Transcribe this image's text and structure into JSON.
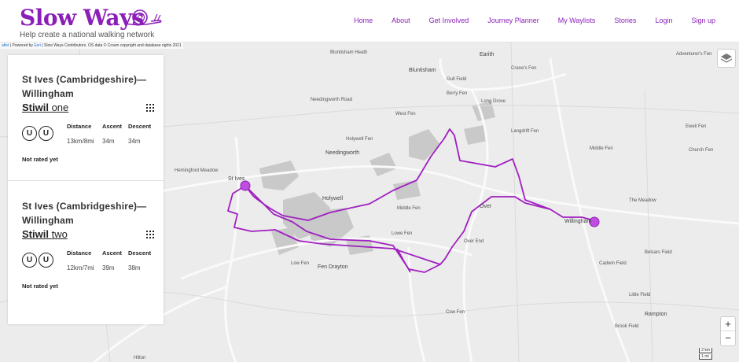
{
  "header": {
    "logo": "Slow Ways",
    "tagline": "Help create a national walking network",
    "nav": [
      "Home",
      "About",
      "Get Involved",
      "Journey Planner",
      "My Waylists",
      "Stories",
      "Login",
      "Sign up"
    ]
  },
  "map": {
    "attribution_prefix": "aflet",
    "attribution_powered": "| Powered by",
    "attribution_esri": "Esri",
    "attribution_rest": "| Slow Ways Contributors. OS data © Crown copyright and database rights 2021",
    "zoom_in": "+",
    "zoom_out": "−",
    "scale_km": "2 km",
    "scale_mi": "1 mi",
    "route_color": "#a020c0",
    "labels": [
      "Bluntisham",
      "Earith",
      "Bluntisham Heath",
      "Gull Field",
      "Crane's Fen",
      "Adventurer's Fen",
      "Berry Fen",
      "Long Drove",
      "Needingworth Road",
      "West Fen",
      "Langdrift Fen",
      "Ewell Fen",
      "Holywell Fen",
      "Church Fen",
      "Needingworth",
      "Middle Fen",
      "Hemingford Meadow",
      "St Ives",
      "Holywell",
      "Over",
      "Willingham",
      "Over End",
      "Low Fen",
      "Fen Drayton",
      "Cadwin Field",
      "Belsars Field",
      "Rampton",
      "Brook Field",
      "Little Field",
      "Cow Fen",
      "The Meadow",
      "Lowe Fen",
      "Middle Fen",
      "Hilton"
    ]
  },
  "routes": [
    {
      "title": "St Ives (Cambridgeshire)—Willingham",
      "name_bold": "Stiwil",
      "name_rest": "one",
      "badges": [
        "U",
        "U"
      ],
      "distance_label": "Distance",
      "distance": "13km/8mi",
      "ascent_label": "Ascent",
      "ascent": "34m",
      "descent_label": "Descent",
      "descent": "34m",
      "rating": "Not rated yet"
    },
    {
      "title": "St Ives (Cambridgeshire)—Willingham",
      "name_bold": "Stiwil",
      "name_rest": "two",
      "badges": [
        "U",
        "U"
      ],
      "distance_label": "Distance",
      "distance": "12km/7mi",
      "ascent_label": "Ascent",
      "ascent": "39m",
      "descent_label": "Descent",
      "descent": "38m",
      "rating": "Not rated yet"
    }
  ]
}
